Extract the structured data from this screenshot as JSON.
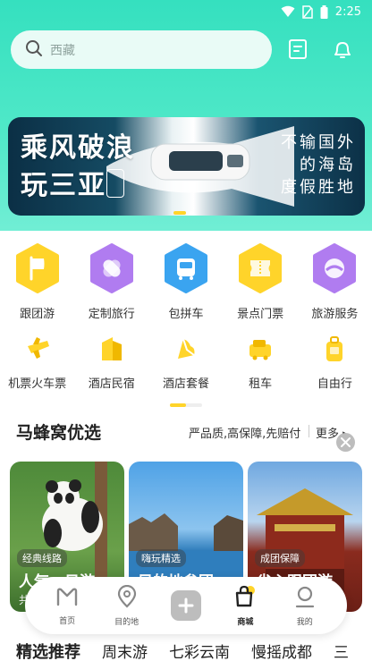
{
  "status_bar": {
    "time": "2:25"
  },
  "search": {
    "placeholder": "西藏"
  },
  "header_icons": [
    "ticket-icon",
    "bell-icon"
  ],
  "banner": {
    "left_title_line1": "乘风破浪",
    "left_title_line2": "玩三亚",
    "right_title_line1": "不输国外",
    "right_title_line2": "的海岛",
    "right_title_line3": "度假胜地",
    "slide_count": 2,
    "active_slide": 1
  },
  "categories_row1": [
    {
      "label": "跟团游",
      "icon": "flag-icon"
    },
    {
      "label": "定制旅行",
      "icon": "custom-trip-icon"
    },
    {
      "label": "包拼车",
      "icon": "bus-icon"
    },
    {
      "label": "景点门票",
      "icon": "ticket-icon"
    },
    {
      "label": "旅游服务",
      "icon": "service-icon"
    }
  ],
  "categories_row2": [
    {
      "label": "机票火车票",
      "icon": "plane-icon"
    },
    {
      "label": "酒店民宿",
      "icon": "hotel-icon"
    },
    {
      "label": "酒店套餐",
      "icon": "hotel-package-icon"
    },
    {
      "label": "租车",
      "icon": "car-icon"
    },
    {
      "label": "自由行",
      "icon": "suitcase-icon"
    }
  ],
  "section": {
    "title": "马蜂窝优选",
    "slogan": "严品质,高保障,先赔付",
    "more": "更多 ▸"
  },
  "cards": [
    {
      "tag": "经典线路",
      "title": "人气一日游",
      "sub": "共"
    },
    {
      "tag": "嗨玩精选",
      "title": "目的地参团",
      "sub": ""
    },
    {
      "tag": "成团保障",
      "title": "省心跟团游",
      "sub": ""
    }
  ],
  "tabbar": {
    "items": [
      {
        "label": "首页",
        "icon": "home-m-icon"
      },
      {
        "label": "目的地",
        "icon": "location-pin-icon"
      },
      {
        "label": "",
        "icon": "plus-icon"
      },
      {
        "label": "商城",
        "icon": "shopping-bag-icon",
        "active": true
      },
      {
        "label": "我的",
        "icon": "profile-icon"
      }
    ],
    "accent": "#ffd42a"
  },
  "bottom_tabs": [
    "精选推荐",
    "周末游",
    "七彩云南",
    "慢摇成都",
    "三"
  ],
  "colors": {
    "brand": "#ffd42a",
    "header_gradient_top": "#35e0bf",
    "hex_yellow": "#ffd42a",
    "hex_purple": "#b07cf0",
    "hex_blue": "#3aa4f0"
  }
}
